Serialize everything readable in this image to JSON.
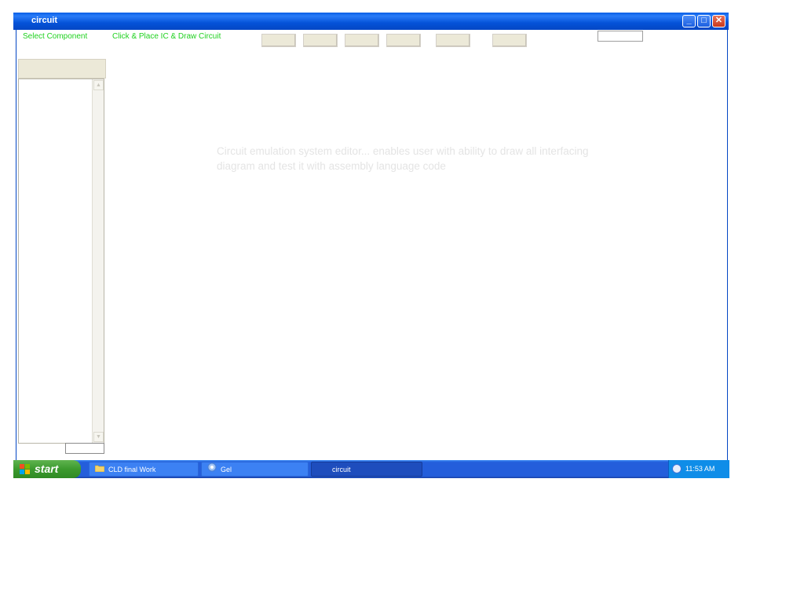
{
  "window": {
    "title": "circuit",
    "controls": {
      "minimize": "_",
      "maximize": "□",
      "close": "✕"
    }
  },
  "toolbar": {
    "select_component_label": "Select Component",
    "click_place_label": "Click & Place IC & Draw Circuit",
    "buttons": [
      "",
      "",
      "",
      "",
      "",
      ""
    ],
    "input_value": ""
  },
  "sidebar": {
    "button_label": "",
    "list_items": [],
    "bottom_input_value": ""
  },
  "main": {
    "description": "Circuit emulation system editor... enables user with ability to draw all interfacing diagram and test it with assembly language code"
  },
  "taskbar": {
    "start_label": "start",
    "tasks": [
      {
        "label": "CLD final Work",
        "icon": "folder-icon",
        "active": false
      },
      {
        "label": "Gel",
        "icon": "app-icon",
        "active": false
      },
      {
        "label": "circuit",
        "icon": "",
        "active": true
      }
    ],
    "clock": "11:53 AM"
  },
  "colors": {
    "titlebar": "#0553d8",
    "label_green": "#1fd11f",
    "taskbar": "#245edb",
    "start_green": "#3c9a2e"
  }
}
